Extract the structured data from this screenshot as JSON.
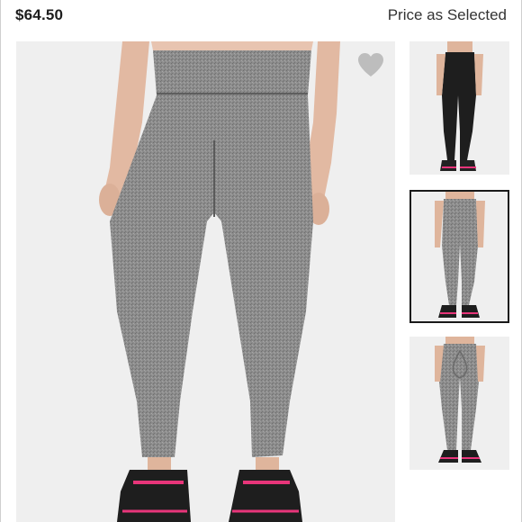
{
  "product": {
    "price": "$64.50",
    "price_note": "Price as Selected"
  },
  "colors": {
    "leggings_gray": "#8a8a8a",
    "leggings_black": "#1e1e1e",
    "shoe_accent": "#e8357a",
    "photo_bg": "#efefef"
  },
  "icons": {
    "favorite": "heart-icon"
  },
  "thumbnails": [
    {
      "variant": "black leggings"
    },
    {
      "variant": "heather gray leggings front",
      "selected": true
    },
    {
      "variant": "heather gray leggings back"
    }
  ]
}
